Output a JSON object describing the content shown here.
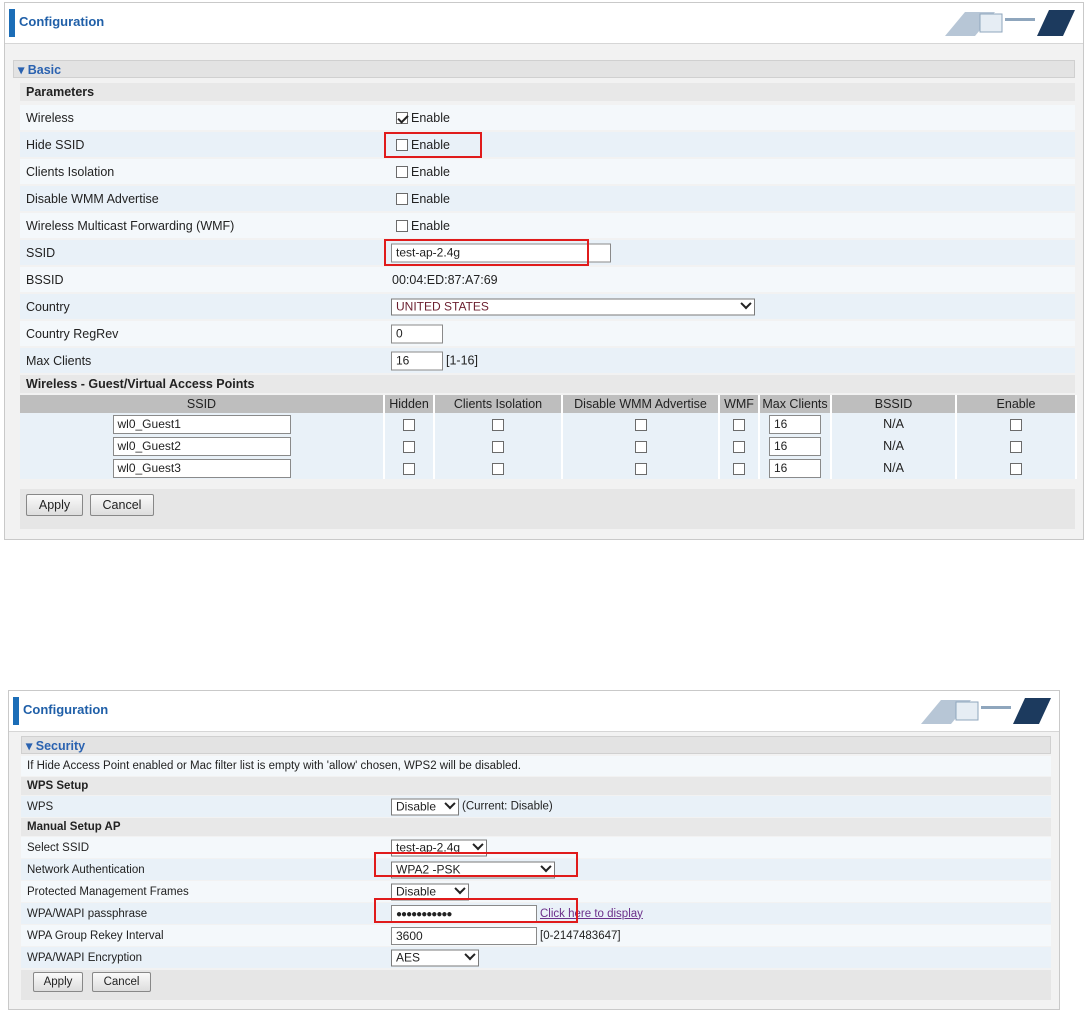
{
  "top": {
    "header_title": "Configuration",
    "section_title": "Basic",
    "parameters_heading": "Parameters",
    "wireless": {
      "label": "Wireless",
      "enable_text": "Enable",
      "checked": true
    },
    "hide_ssid": {
      "label": "Hide SSID",
      "enable_text": "Enable",
      "checked": false
    },
    "clients_isolation": {
      "label": "Clients Isolation",
      "enable_text": "Enable",
      "checked": false
    },
    "disable_wmm": {
      "label": "Disable WMM Advertise",
      "enable_text": "Enable",
      "checked": false
    },
    "wmf": {
      "label": "Wireless Multicast Forwarding (WMF)",
      "enable_text": "Enable",
      "checked": false
    },
    "ssid": {
      "label": "SSID",
      "value": "test-ap-2.4g"
    },
    "bssid": {
      "label": "BSSID",
      "value": "00:04:ED:87:A7:69"
    },
    "country": {
      "label": "Country",
      "value": "UNITED STATES"
    },
    "country_regrev": {
      "label": "Country RegRev",
      "value": "0"
    },
    "max_clients": {
      "label": "Max Clients",
      "value": "16",
      "range": "[1-16]"
    },
    "guest_heading": "Wireless - Guest/Virtual Access Points",
    "guest_columns": [
      "SSID",
      "Hidden",
      "Clients Isolation",
      "Disable WMM Advertise",
      "WMF",
      "Max Clients",
      "BSSID",
      "Enable"
    ],
    "guest_rows": [
      {
        "ssid": "wl0_Guest1",
        "max_clients": "16",
        "bssid": "N/A"
      },
      {
        "ssid": "wl0_Guest2",
        "max_clients": "16",
        "bssid": "N/A"
      },
      {
        "ssid": "wl0_Guest3",
        "max_clients": "16",
        "bssid": "N/A"
      }
    ],
    "apply_label": "Apply",
    "cancel_label": "Cancel"
  },
  "bottom": {
    "header_title": "Configuration",
    "section_title": "Security",
    "notice": "If Hide Access Point enabled or Mac filter list is empty with 'allow' chosen, WPS2 will be disabled.",
    "wps_setup_heading": "WPS Setup",
    "wps": {
      "label": "WPS",
      "value": "Disable",
      "current": "(Current: Disable)"
    },
    "manual_heading": "Manual Setup AP",
    "select_ssid": {
      "label": "Select SSID",
      "value": "test-ap-2.4g"
    },
    "network_auth": {
      "label": "Network Authentication",
      "value": "WPA2 -PSK"
    },
    "pmf": {
      "label": "Protected Management Frames",
      "value": "Disable"
    },
    "passphrase": {
      "label": "WPA/WAPI passphrase",
      "value": "●●●●●●●●●●●",
      "link": "Click here to display"
    },
    "rekey": {
      "label": "WPA Group Rekey Interval",
      "value": "3600",
      "range": "[0-2147483647]"
    },
    "encryption": {
      "label": "WPA/WAPI Encryption",
      "value": "AES"
    },
    "apply_label": "Apply",
    "cancel_label": "Cancel"
  }
}
